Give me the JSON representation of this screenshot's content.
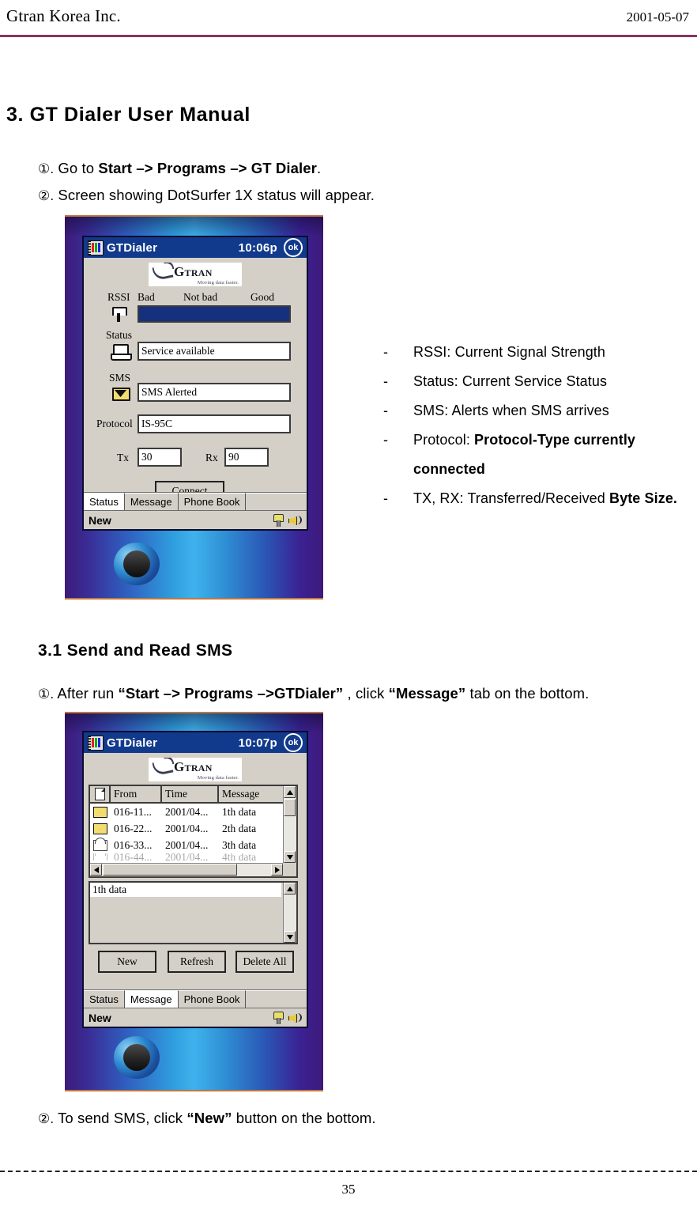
{
  "header": {
    "company": "Gtran Korea Inc.",
    "date": "2001-05-07"
  },
  "section": {
    "title": "3. GT Dialer User Manual",
    "steps": [
      {
        "num": "①.",
        "pre": "Go to ",
        "bold": "Start –> Programs –> GT Dialer",
        "post": "."
      },
      {
        "num": "②.",
        "pre": "Screen showing DotSurfer 1X status will appear.",
        "bold": "",
        "post": ""
      }
    ]
  },
  "bullets": [
    {
      "dash": "-",
      "pre": "RSSI: Current Signal Strength",
      "bold": "",
      "post": ""
    },
    {
      "dash": "-",
      "pre": "Status: Current Service Status",
      "bold": "",
      "post": ""
    },
    {
      "dash": "-",
      "pre": "SMS: Alerts when SMS arrives",
      "bold": "",
      "post": ""
    },
    {
      "dash": "-",
      "pre": "Protocol: ",
      "bold": "Protocol-Type currently connected",
      "post": ""
    },
    {
      "dash": "-",
      "pre": "TX, RX: Transferred/Received ",
      "bold": "Byte Size.",
      "post": ""
    }
  ],
  "subsection": {
    "title": "3.1 Send and Read SMS",
    "steps": [
      {
        "num": "①.",
        "pre": "After run ",
        "bold": "“Start –> Programs –>GTDialer”",
        "post": " , click ",
        "bold2": "“Message”",
        "post2": " tab on the bottom."
      },
      {
        "num": "②.",
        "pre": "To send SMS, click ",
        "bold": "“New”",
        "post": " button on the bottom.",
        "bold2": "",
        "post2": ""
      }
    ]
  },
  "device_status": {
    "titlebar": {
      "icon": "gtdialer-app-icon",
      "title": "GTDialer",
      "time": "10:06p",
      "ok": "ok"
    },
    "logo": {
      "word": "G",
      "word_rest": "TRAN",
      "tm": "™",
      "tagline": "Moving data faster."
    },
    "rssi": {
      "label": "RSSI",
      "icon": "antenna-icon",
      "scale": [
        "Bad",
        "Not bad",
        "Good"
      ],
      "level_percent": 100,
      "bar_color": "#16307e"
    },
    "status": {
      "label": "Status",
      "icon": "laptop-icon",
      "value": "Service available"
    },
    "sms": {
      "label": "SMS",
      "icon": "envelope-icon",
      "value": "SMS Alerted"
    },
    "protocol": {
      "label": "Protocol",
      "value": "IS-95C"
    },
    "tx": {
      "label": "Tx",
      "value": "30"
    },
    "rx": {
      "label": "Rx",
      "value": "90"
    },
    "connect_button": "Connect",
    "tabs": [
      {
        "label": "Status",
        "active": true
      },
      {
        "label": "Message",
        "active": false
      },
      {
        "label": "Phone Book",
        "active": false
      }
    ],
    "cmdbar": {
      "label": "New",
      "icons": [
        "power-plug-icon",
        "speaker-icon"
      ]
    }
  },
  "device_message": {
    "titlebar": {
      "icon": "gtdialer-app-icon",
      "title": "GTDialer",
      "time": "10:07p",
      "ok": "ok"
    },
    "logo": {
      "word": "G",
      "word_rest": "TRAN",
      "tm": "™",
      "tagline": "Moving data faster."
    },
    "grid": {
      "columns": [
        "",
        "From",
        "Time",
        "Message"
      ],
      "rows": [
        {
          "icon": "unread-envelope-icon",
          "from": "016-11...",
          "time": "2001/04...",
          "message": "1th data"
        },
        {
          "icon": "unread-envelope-icon",
          "from": "016-22...",
          "time": "2001/04...",
          "message": "2th data"
        },
        {
          "icon": "read-envelope-icon",
          "from": "016-33...",
          "time": "2001/04...",
          "message": "3th data"
        }
      ]
    },
    "preview": "1th data",
    "buttons": [
      "New",
      "Refresh",
      "Delete All"
    ],
    "tabs": [
      {
        "label": "Status",
        "active": false
      },
      {
        "label": "Message",
        "active": true
      },
      {
        "label": "Phone Book",
        "active": false
      }
    ],
    "cmdbar": {
      "label": "New",
      "icons": [
        "power-plug-icon",
        "speaker-icon"
      ]
    }
  },
  "footer": {
    "page_number": "35"
  }
}
